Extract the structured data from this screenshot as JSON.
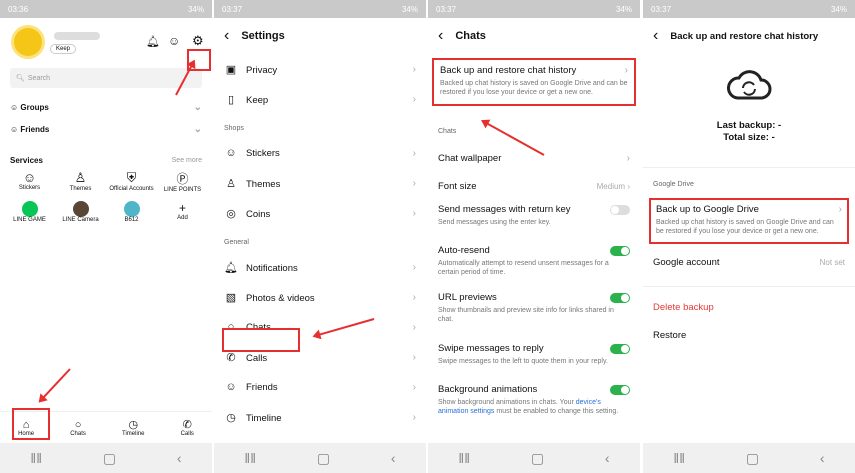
{
  "panel1": {
    "status": {
      "time": "03:36",
      "right": "34%"
    },
    "profile_badge": "Keep",
    "search_placeholder": "Search",
    "groups": "Groups",
    "friends": "Friends",
    "services_title": "Services",
    "see_more": "See more",
    "services": [
      "Stickers",
      "Themes",
      "Official Accounts",
      "LINE POINTS",
      "LINE GAME",
      "LINE Camera",
      "B612",
      "Add"
    ],
    "tabs": [
      "Home",
      "Chats",
      "Timeline",
      "Calls"
    ]
  },
  "panel2": {
    "status": {
      "time": "03:37",
      "right": "34%"
    },
    "title": "Settings",
    "items": [
      "Privacy",
      "Keep"
    ],
    "shops_header": "Shops",
    "shop_items": [
      "Stickers",
      "Themes",
      "Coins"
    ],
    "general_header": "General",
    "general_items": [
      "Notifications",
      "Photos & videos",
      "Chats",
      "Calls",
      "Friends",
      "Timeline"
    ]
  },
  "panel3": {
    "status": {
      "time": "03:37",
      "right": "34%"
    },
    "title": "Chats",
    "backup_title": "Back up and restore chat history",
    "backup_desc": "Backed up chat history is saved on Google Drive and can be restored if you lose your device or get a new one.",
    "chats_header": "Chats",
    "wallpaper": "Chat wallpaper",
    "font_size": "Font size",
    "font_size_value": "Medium",
    "send_return": "Send messages with return key",
    "send_return_desc": "Send messages using the enter key.",
    "auto_resend": "Auto-resend",
    "auto_resend_desc": "Automatically attempt to resend unsent messages for a certain period of time.",
    "url_previews": "URL previews",
    "url_previews_desc": "Show thumbnails and preview site info for links shared in chat.",
    "swipe": "Swipe messages to reply",
    "swipe_desc": "Swipe messages to the left to quote them in your reply.",
    "bg_anim": "Background animations",
    "bg_anim_desc_1": "Show background animations in chats. Your ",
    "bg_anim_link": "device's animation settings",
    "bg_anim_desc_2": " must be enabled to change this setting."
  },
  "panel4": {
    "status": {
      "time": "03:37",
      "right": "34%"
    },
    "title": "Back up and restore chat history",
    "last_backup": "Last backup: -",
    "total_size": "Total size: -",
    "gdrive_header": "Google Drive",
    "backup_to_gdrive": "Back up to Google Drive",
    "backup_desc": "Backed up chat history is saved on Google Drive and can be restored if you lose your device or get a new one.",
    "google_account": "Google account",
    "not_set": "Not set",
    "delete_backup": "Delete backup",
    "restore": "Restore"
  },
  "colors": {
    "highlight": "#e63030",
    "toggle_on": "#2bb24c",
    "delete": "#e53935",
    "link": "#2a6fd6"
  }
}
